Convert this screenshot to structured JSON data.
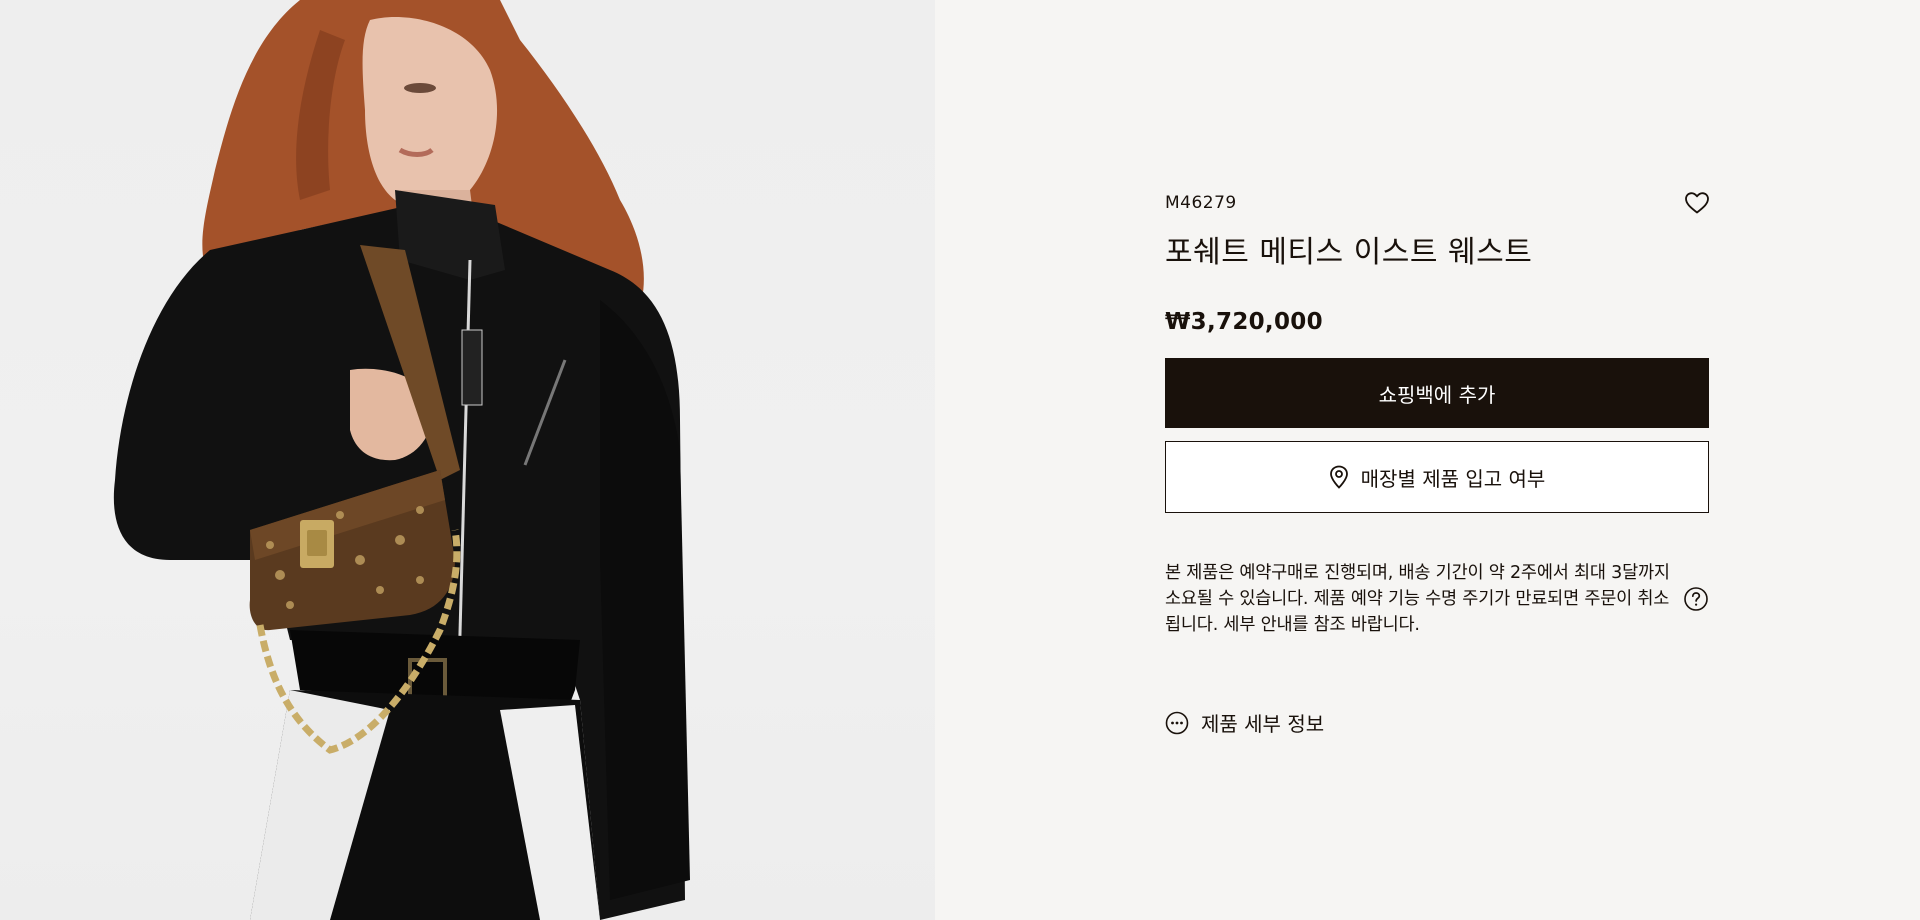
{
  "product": {
    "sku": "M46279",
    "name": "포쉐트 메티스 이스트 웨스트",
    "price": "₩3,720,000"
  },
  "actions": {
    "add_to_bag_label": "쇼핑백에 추가",
    "store_availability_label": "매장별 제품 입고 여부"
  },
  "notice": {
    "text": "본 제품은 예약구매로 진행되며, 배송 기간이 약 2주에서 최대 3달까지 소요될 수 있습니다. 제품 예약 기능 수명 주기가 만료되면 주문이 취소됩니다. 세부 안내를 참조 바랍니다."
  },
  "details": {
    "label": "제품 세부 정보"
  },
  "icons": {
    "wishlist": "heart-icon",
    "store": "location-pin-icon",
    "help": "question-circle-icon",
    "details": "more-circle-icon"
  },
  "colors": {
    "background": "#f6f5f3",
    "primary": "#19110b",
    "image_background": "#eeeeee"
  }
}
